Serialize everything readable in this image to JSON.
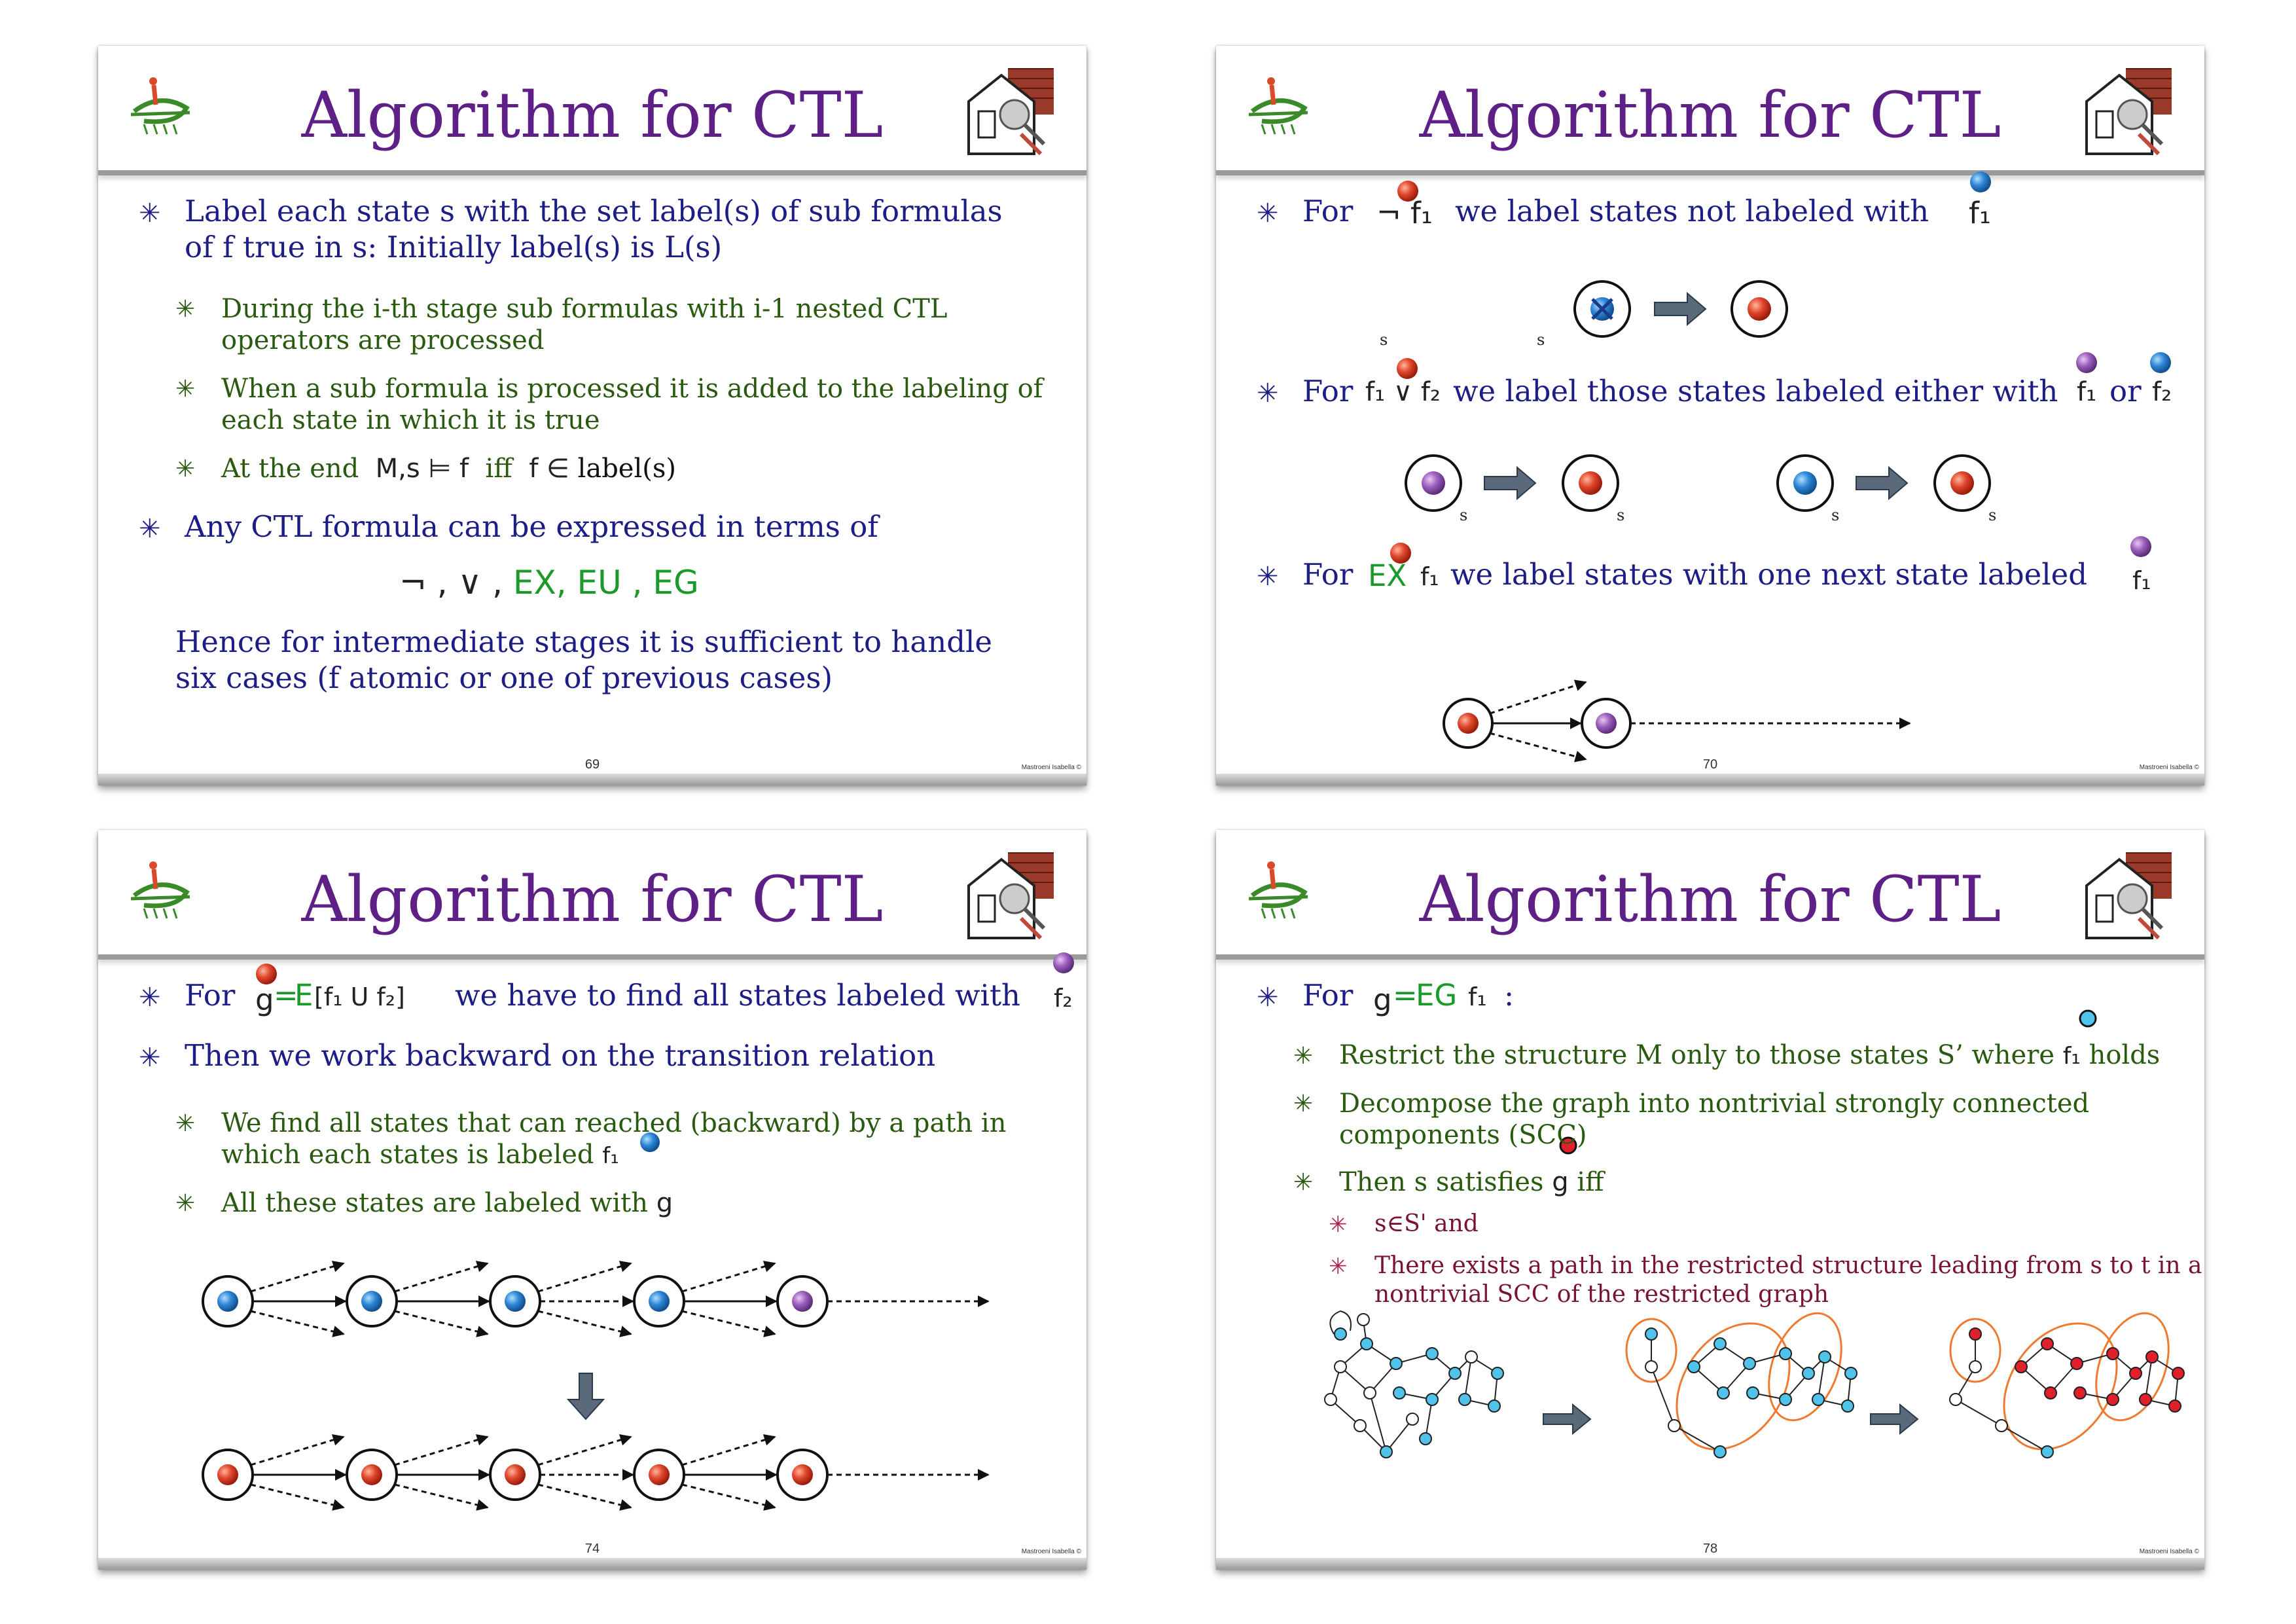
{
  "slides": [
    {
      "title": "Algorithm for CTL",
      "page": "69",
      "copyright": "Mastroeni Isabella ©",
      "bullets": {
        "b1_l1": "Label each state s with the set label(s) of sub formulas",
        "b1_l2": "of f true in s: Initially label(s) is L(s)",
        "b2_l1": "During the i-th stage sub formulas with i-1 nested CTL",
        "b2_l2": "operators are processed",
        "b3_l1": "When a sub formula is processed it is added to the labeling of",
        "b3_l2": "each state in which it is true",
        "b4_pre": "At the end",
        "b4_formula": "M,s ⊨ f",
        "b4_iff": "iff",
        "b4_f": "f ∈",
        "b4_label": "label(s)",
        "b5": "Any CTL formula can be expressed in terms of",
        "ops_basic": "¬ , ∨ ,",
        "ops_ex": "EX,",
        "ops_eu": "EU ,",
        "ops_eg": "EG",
        "hence_l1": "Hence for intermediate stages it is sufficient to handle",
        "hence_l2": "six cases (f atomic or one of previous cases)"
      }
    },
    {
      "title": "Algorithm for CTL",
      "page": "70",
      "copyright": "Mastroeni Isabella ©",
      "bullets": {
        "for1": "For",
        "neg_formula": "¬ f₁",
        "rest1": "we label states not labeled with",
        "f1": "f₁",
        "for2": "For",
        "or_formula": "f₁ ∨ f₂",
        "rest2": "we label those states labeled either with",
        "or_word": "or",
        "f2": "f₂",
        "for3": "For",
        "ex": "EX",
        "ex_f": "f₁",
        "rest3": "we label states with one next state labeled",
        "f1b": "f₁",
        "s": "s"
      }
    },
    {
      "title": "Algorithm for CTL",
      "page": "74",
      "copyright": "Mastroeni Isabella ©",
      "bullets": {
        "for": "For",
        "g": "g",
        "eq": "=",
        "eu": "E",
        "eu_inner": "[f₁ U f₂]",
        "rest1": "we have to find all states labeled with",
        "f2": "f₂",
        "b2": "Then we work backward on the transition relation",
        "b3_l1": "We find all states that can reached (backward) by a path in",
        "b3_l2": "which each states is labeled",
        "f1": "f₁",
        "b4": "All these states are labeled with",
        "g2": "g"
      }
    },
    {
      "title": "Algorithm for CTL",
      "page": "78",
      "copyright": "Mastroeni Isabella ©",
      "bullets": {
        "for": "For",
        "g": "g",
        "eq": "=",
        "eg": "EG",
        "f1": "f₁",
        "colon": ":",
        "b2_pre": "Restrict the structure M only to those states S’ where",
        "f1b": "f₁",
        "b2_post": "holds",
        "b3_l1": "Decompose the graph into nontrivial strongly connected",
        "b3_l2": "components (SCC)",
        "b4_pre": "Then s satisfies",
        "g2": "g",
        "b4_post": "iff",
        "b5": "s∈S' and",
        "b6_l1": "There exists a path in the restricted structure leading from s to t in a",
        "b6_l2": "nontrivial SCC of the restricted graph"
      }
    }
  ],
  "colors": {
    "title": "#5e1f86",
    "bullet1": "#1d1d86",
    "bullet2": "#2a5a10",
    "bullet3": "#7a1237",
    "red_state": "#d8402a",
    "blue_state": "#2d7fd0",
    "purple_state": "#9a5bb8",
    "cyan_state": "#4fc3ea"
  }
}
